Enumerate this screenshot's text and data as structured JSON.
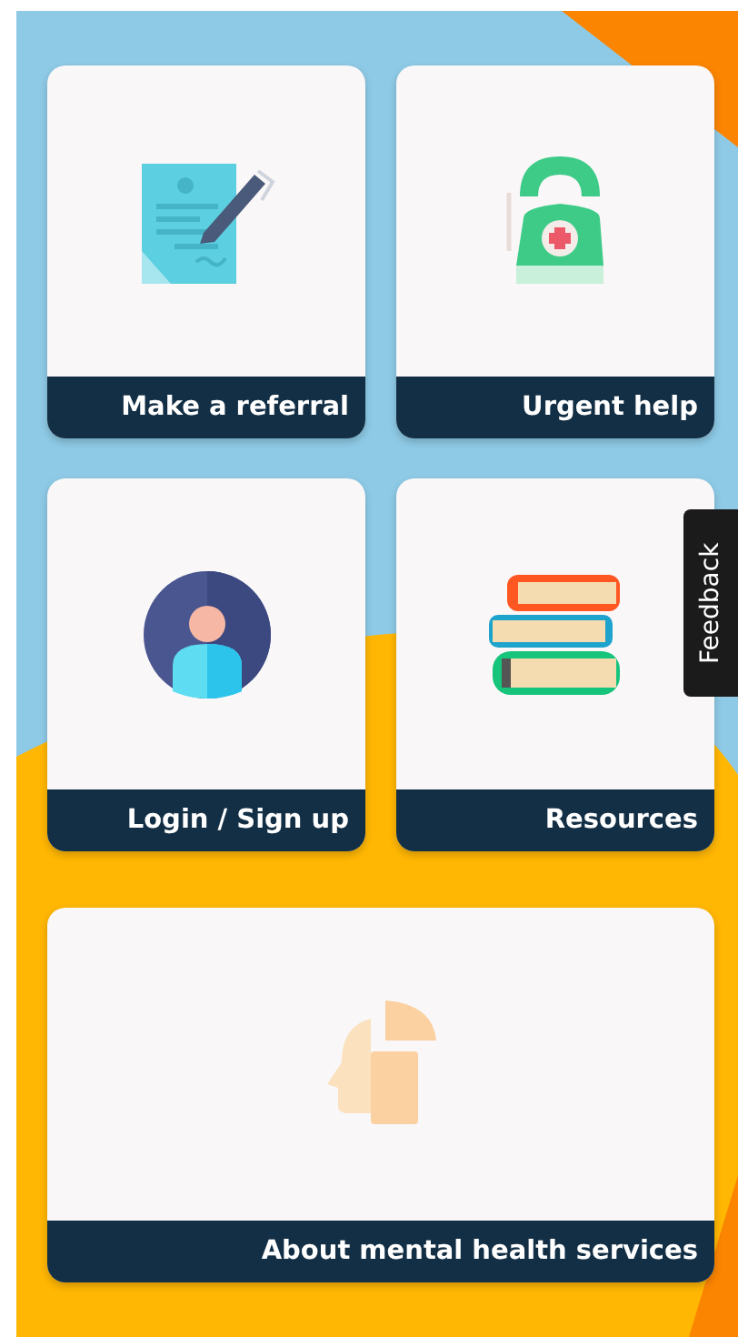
{
  "cards": [
    {
      "label": "Make a referral",
      "kind": "document"
    },
    {
      "label": "Urgent help",
      "kind": "phone"
    },
    {
      "label": "Login / Sign up",
      "kind": "person"
    },
    {
      "label": "Resources",
      "kind": "books"
    },
    {
      "label": "About mental health services",
      "kind": "head"
    }
  ],
  "feedback_tab": {
    "label": "Feedback"
  }
}
